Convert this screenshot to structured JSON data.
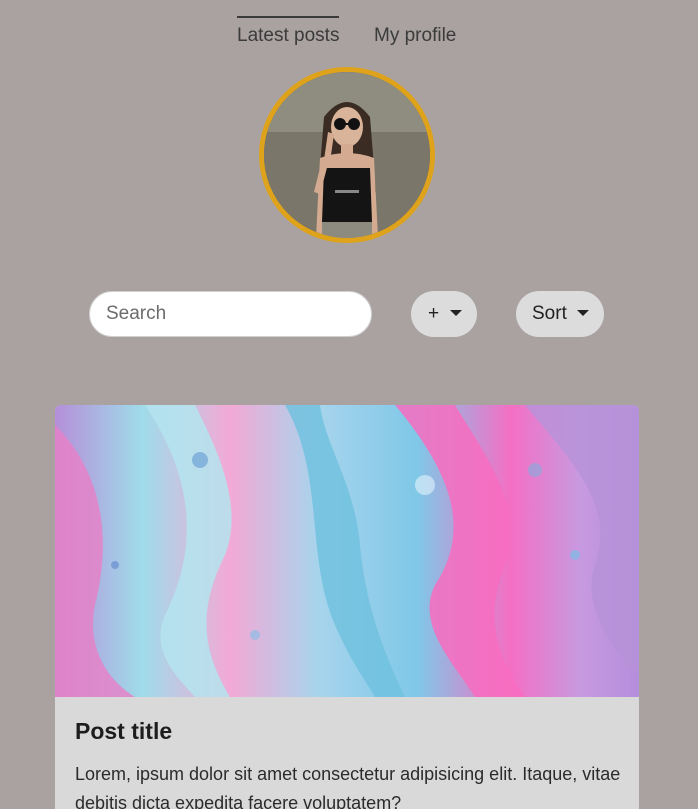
{
  "nav": {
    "tabs": [
      {
        "label": "Latest posts",
        "active": true
      },
      {
        "label": "My profile",
        "active": false
      }
    ]
  },
  "profile": {
    "avatar_icon": "profile-photo",
    "avatar_ring_color": "#dea31a"
  },
  "toolbar": {
    "search_placeholder": "Search",
    "add_label": "+",
    "sort_label": "Sort"
  },
  "post": {
    "title": "Post title",
    "body": "Lorem, ipsum dolor sit amet consectetur adipisicing elit. Itaque, vitae debitis dicta expedita facere voluptatem?"
  },
  "colors": {
    "background": "#a9a2a1",
    "card": "#d9d9d9",
    "pill": "#dcdcdc"
  }
}
